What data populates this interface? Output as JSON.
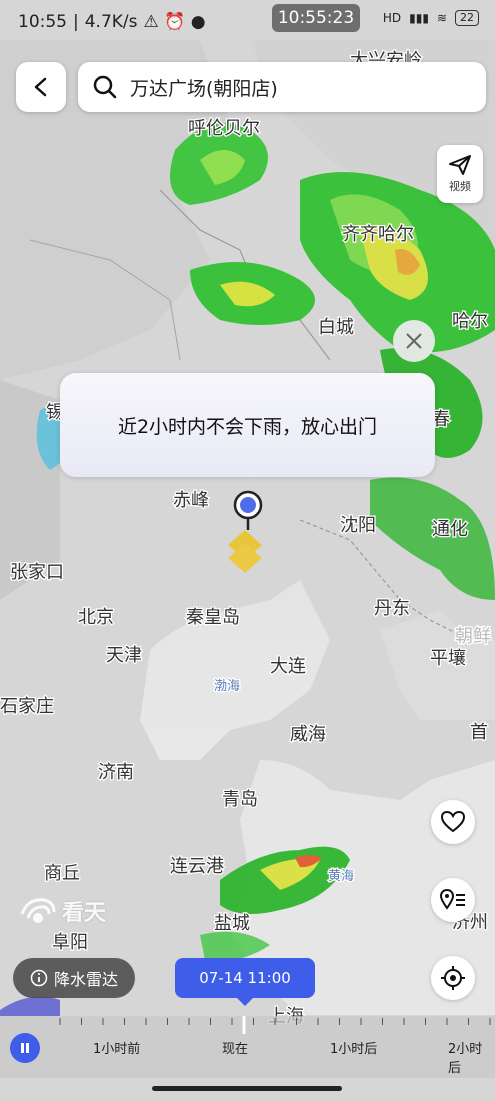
{
  "status_bar": {
    "time": "10:55",
    "network_speed": "4.7K/s",
    "center_time": "10:55:23",
    "signal": "HD",
    "battery": "22"
  },
  "search": {
    "text": "万达广场(朝阳店)"
  },
  "share": {
    "label": "视频"
  },
  "tip": {
    "message": "近2小时内不会下雨，放心出门"
  },
  "map": {
    "places": [
      {
        "name": "大兴安岭"
      },
      {
        "name": "呼伦贝尔"
      },
      {
        "name": "齐齐哈尔"
      },
      {
        "name": "白城"
      },
      {
        "name": "哈尔"
      },
      {
        "name": "赤峰"
      },
      {
        "name": "沈阳"
      },
      {
        "name": "通化"
      },
      {
        "name": "张家口"
      },
      {
        "name": "北京"
      },
      {
        "name": "秦皇岛"
      },
      {
        "name": "丹东"
      },
      {
        "name": "天津"
      },
      {
        "name": "大连"
      },
      {
        "name": "平壤"
      },
      {
        "name": "渤海"
      },
      {
        "name": "石家庄"
      },
      {
        "name": "威海"
      },
      {
        "name": "济南"
      },
      {
        "name": "青岛"
      },
      {
        "name": "连云港"
      },
      {
        "name": "黄海"
      },
      {
        "name": "商丘"
      },
      {
        "name": "盐城"
      },
      {
        "name": "阜阳"
      },
      {
        "name": "上海"
      },
      {
        "name": "朝鲜"
      },
      {
        "name": "春"
      },
      {
        "name": "锡"
      },
      {
        "name": "首"
      },
      {
        "name": "济州"
      }
    ],
    "watermark": "看天"
  },
  "legend_button": {
    "label": "降水雷达"
  },
  "time_tag": {
    "label": "07-14 11:00"
  },
  "timeline": {
    "labels": [
      "1小时前",
      "现在",
      "1小时后",
      "2小时后"
    ]
  }
}
